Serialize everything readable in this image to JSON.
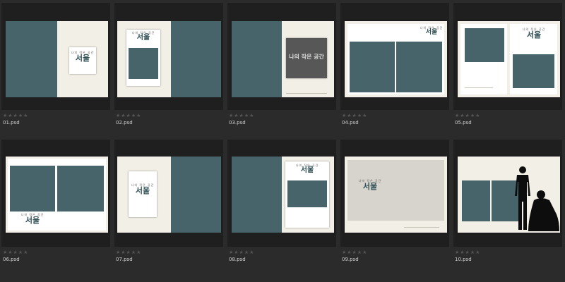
{
  "thumbnails": [
    {
      "file": "01.psd",
      "stars": "★★★★★"
    },
    {
      "file": "02.psd",
      "stars": "★★★★★"
    },
    {
      "file": "03.psd",
      "stars": "★★★★★"
    },
    {
      "file": "04.psd",
      "stars": "★★★★★"
    },
    {
      "file": "05.psd",
      "stars": "★★★★★"
    },
    {
      "file": "06.psd",
      "stars": "★★★★★"
    },
    {
      "file": "07.psd",
      "stars": "★★★★★"
    },
    {
      "file": "08.psd",
      "stars": "★★★★★"
    },
    {
      "file": "09.psd",
      "stars": "★★★★★"
    },
    {
      "file": "10.psd",
      "stars": "★★★★★"
    }
  ],
  "logo": {
    "small": "나의 작은 공간",
    "big": "서울"
  },
  "colors": {
    "teal": "#46646a",
    "cream": "#f2efe6",
    "grey": "#d7d4cd",
    "background": "#2b2b2b"
  }
}
